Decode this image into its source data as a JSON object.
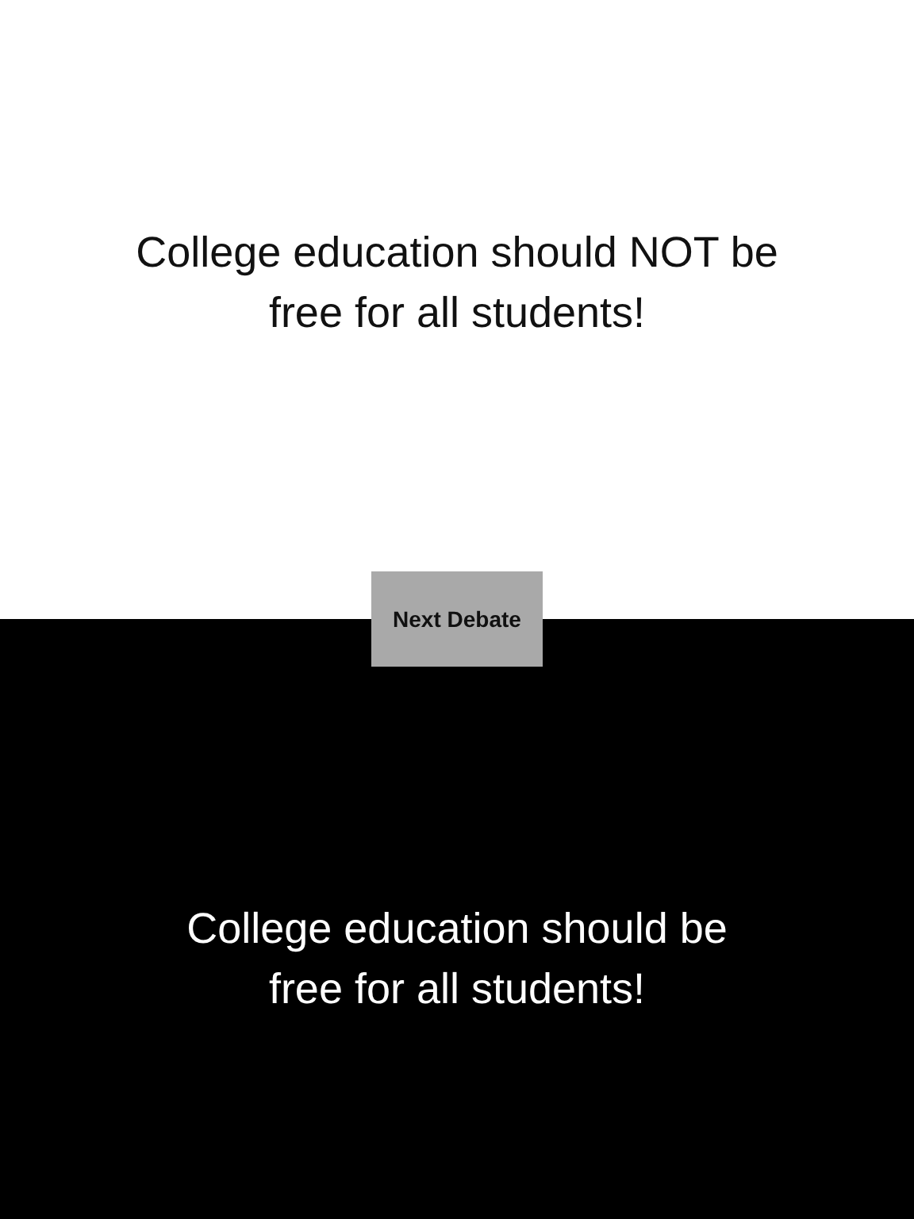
{
  "top_panel": {
    "statement": "College education should NOT be free for all students!"
  },
  "next_button": {
    "label": "Next Debate"
  },
  "bottom_panel": {
    "statement": "College education should be free for all students!"
  }
}
